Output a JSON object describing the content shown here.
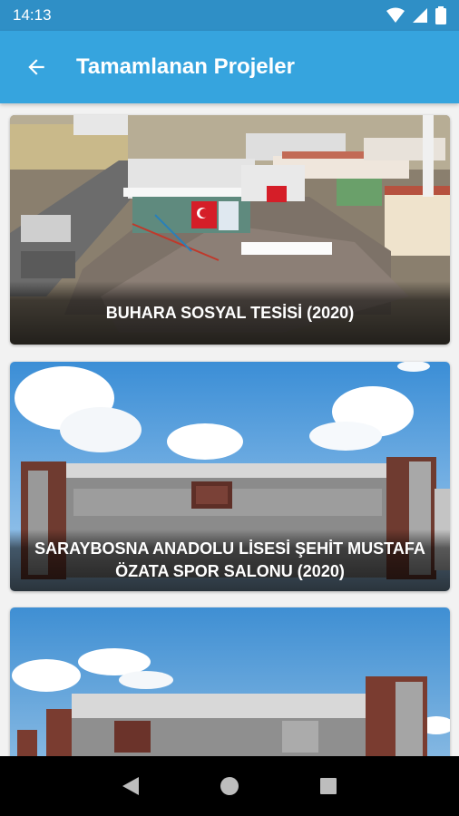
{
  "status_bar": {
    "time": "14:13",
    "icons": [
      "wifi-icon",
      "signal-icon",
      "battery-icon"
    ]
  },
  "app_bar": {
    "title": "Tamamlanan Projeler",
    "back_icon": "arrow-left-icon"
  },
  "projects": [
    {
      "title": "BUHARA SOSYAL TESİSİ (2020)"
    },
    {
      "title": "SARAYBOSNA ANADOLU LİSESİ ŞEHİT MUSTAFA ÖZATA SPOR SALONU (2020)"
    },
    {
      "title": ""
    }
  ],
  "nav_bar": {
    "icons": [
      "back-triangle-icon",
      "home-circle-icon",
      "recents-square-icon"
    ]
  },
  "colors": {
    "status_bar": "#2f8fc6",
    "app_bar": "#36a4de",
    "nav_bar": "#000000"
  }
}
